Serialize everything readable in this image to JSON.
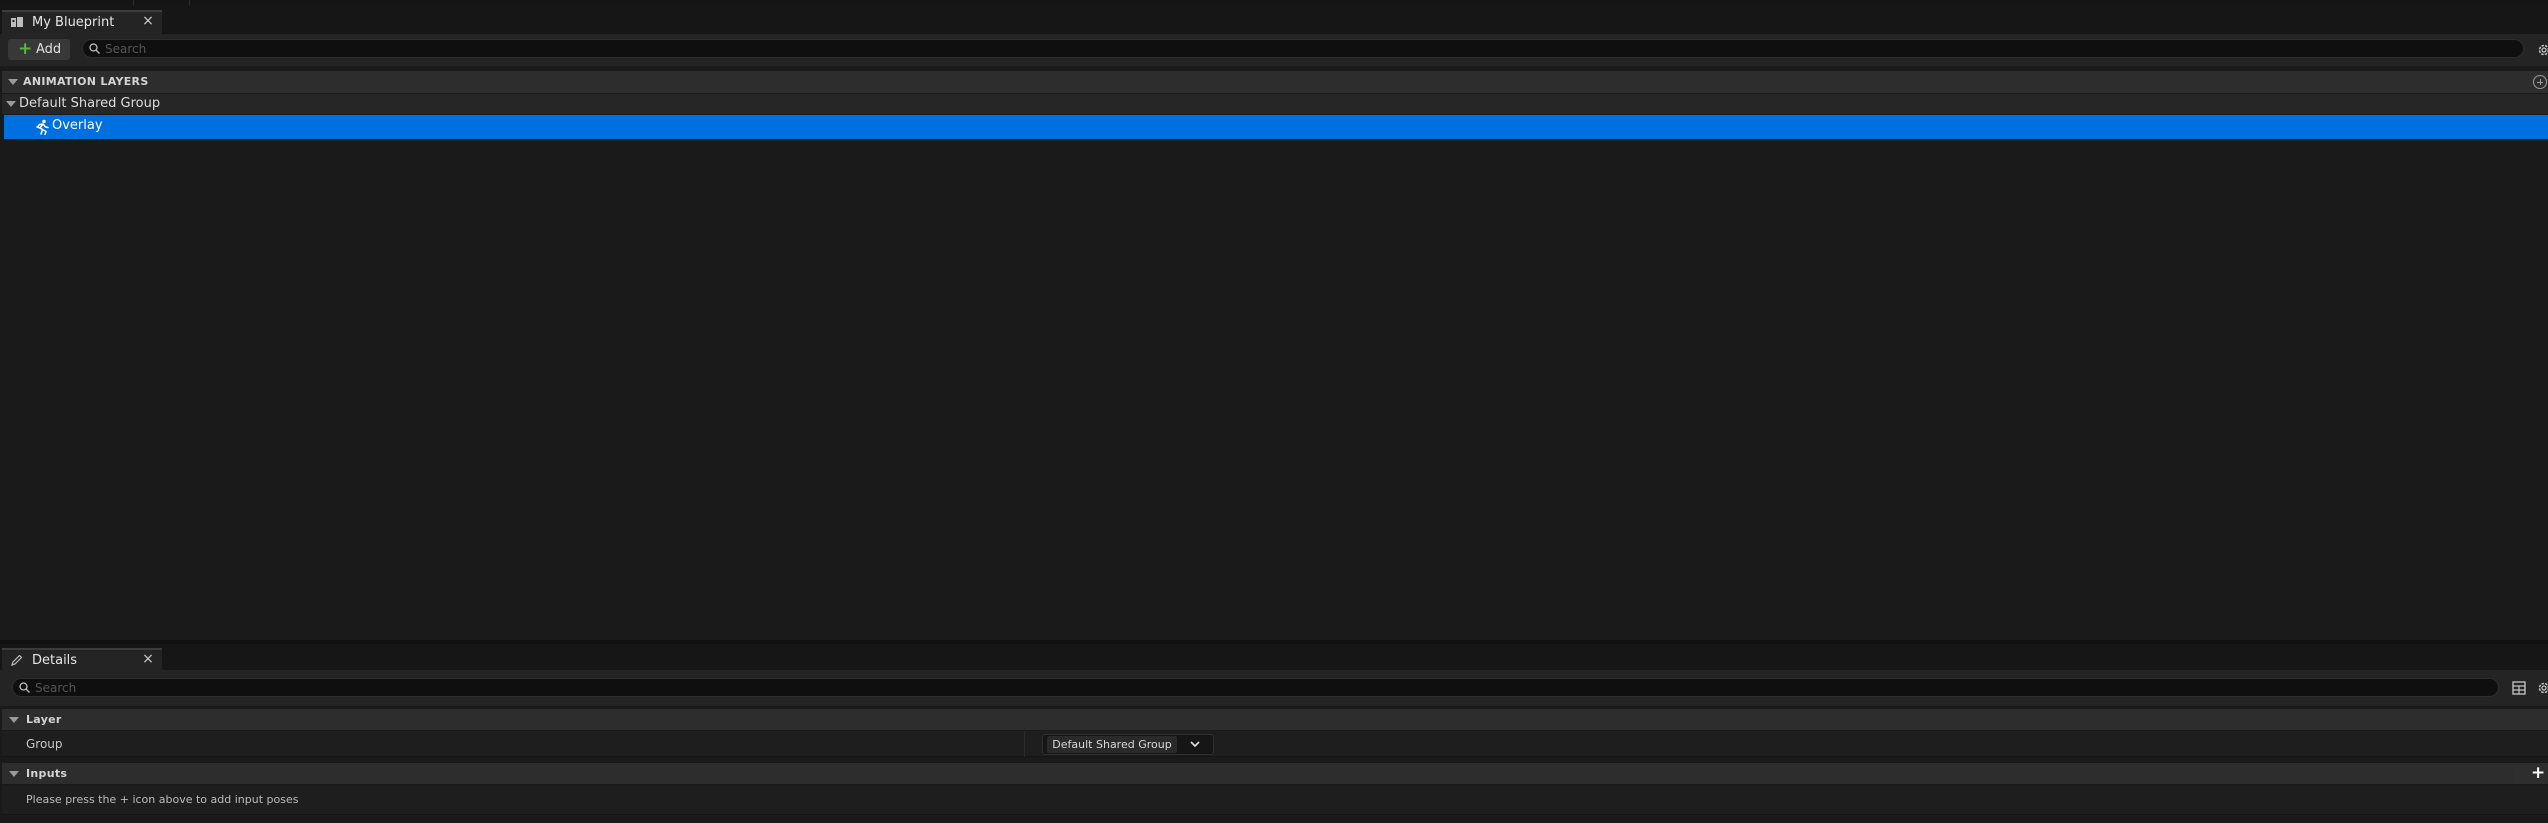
{
  "blueprint_panel": {
    "tab_title": "My Blueprint",
    "tab_close": "×",
    "add_label": "Add",
    "add_symbol": "+",
    "search_placeholder": "Search",
    "section_title": "ANIMATION LAYERS",
    "group_name": "Default Shared Group",
    "layers": [
      {
        "label": "Overlay",
        "selected": true
      }
    ]
  },
  "details_panel": {
    "tab_title": "Details",
    "tab_close": "×",
    "search_placeholder": "Search",
    "layer_section": "Layer",
    "group_property": "Group",
    "group_value": "Default Shared Group",
    "inputs_section": "Inputs",
    "add_input_symbol": "+",
    "inputs_hint": "Please press the + icon above to add input poses"
  },
  "colors": {
    "selection": "#0070e0",
    "add_plus": "#5ab53b",
    "background": "#1a1a1a"
  },
  "icons": [
    "blueprint-tab-icon",
    "close-icon",
    "plus-icon",
    "search-icon",
    "gear-icon",
    "add-circle-icon",
    "collapse-arrow-icon",
    "running-man-icon",
    "pencil-icon",
    "grid-view-icon",
    "chevron-down-icon"
  ]
}
